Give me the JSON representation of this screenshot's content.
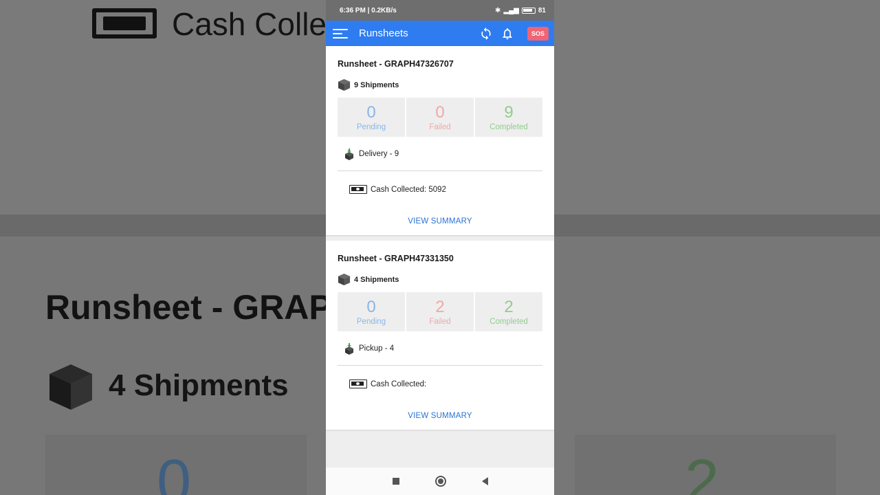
{
  "background": {
    "cash_text": "Cash Collec",
    "runsheet_text": "Runsheet - GRAP",
    "shipments_text": "4 Shipments",
    "left_number": "0",
    "right_number": "2"
  },
  "status_bar": {
    "left": "6:36 PM | 0.2KB/s",
    "battery": "81"
  },
  "app_bar": {
    "title": "Runsheets",
    "sos_label": "SOS"
  },
  "runsheets": [
    {
      "title": "Runsheet - GRAPH47326707",
      "shipments": "9 Shipments",
      "pending": "0",
      "pending_label": "Pending",
      "failed": "0",
      "failed_label": "Failed",
      "completed": "9",
      "completed_label": "Completed",
      "type_label": "Delivery - 9",
      "cash_label": "Cash Collected: 5092",
      "summary_label": "VIEW SUMMARY"
    },
    {
      "title": "Runsheet - GRAPH47331350",
      "shipments": "4 Shipments",
      "pending": "0",
      "pending_label": "Pending",
      "failed": "2",
      "failed_label": "Failed",
      "completed": "2",
      "completed_label": "Completed",
      "type_label": "Pickup - 4",
      "cash_label": "Cash Collected:",
      "summary_label": "VIEW SUMMARY"
    }
  ],
  "colors": {
    "app_bar": "#2f7cf0",
    "sos": "#f06474",
    "pending": "#8ab6e6",
    "failed": "#f2a7a7",
    "completed": "#92cc8f",
    "link": "#2a72d4"
  },
  "icons": {
    "menu": "menu-icon",
    "refresh": "refresh-icon",
    "bell": "bell-icon",
    "box": "box-icon",
    "delivery": "delivery-package-icon",
    "cash": "cash-icon"
  }
}
